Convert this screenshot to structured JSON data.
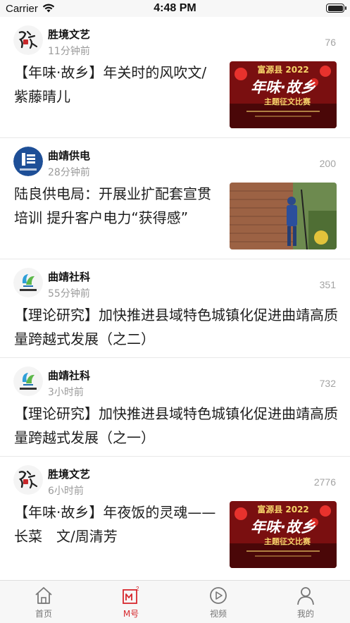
{
  "status_bar": {
    "carrier": "Carrier",
    "time": "4:48 PM"
  },
  "feed": [
    {
      "source": "胜境文艺",
      "time": "11分钟前",
      "count": "76",
      "title": "【年味·故乡】年关时的风吹文/紫藤晴儿",
      "thumbnail": "contest-poster",
      "thumb_text": {
        "header": "富源县 2022",
        "calligraphy": "年味·故乡",
        "subtitle": "主题征文比赛"
      }
    },
    {
      "source": "曲靖供电",
      "time": "28分钟前",
      "count": "200",
      "title": "陆良供电局：开展业扩配套宣贯培训 提升客户电力“获得感”",
      "thumbnail": "electric-worker-photo"
    },
    {
      "source": "曲靖社科",
      "time": "55分钟前",
      "count": "351",
      "title": "【理论研究】加快推进县域特色城镇化促进曲靖高质量跨越式发展（之二）"
    },
    {
      "source": "曲靖社科",
      "time": "3小时前",
      "count": "732",
      "title": "【理论研究】加快推进县域特色城镇化促进曲靖高质量跨越式发展（之一）"
    },
    {
      "source": "胜境文艺",
      "time": "6小时前",
      "count": "2776",
      "title": "【年味·故乡】年夜饭的灵魂——长菜　文/周清芳",
      "thumbnail": "contest-poster",
      "thumb_text": {
        "header": "富源县 2022",
        "calligraphy": "年味·故乡",
        "subtitle": "主题征文比赛"
      }
    }
  ],
  "tabs": [
    {
      "label": "首页",
      "icon": "home-icon",
      "active": false
    },
    {
      "label": "M号",
      "icon": "m-number-icon",
      "active": true
    },
    {
      "label": "视频",
      "icon": "play-icon",
      "active": false
    },
    {
      "label": "我的",
      "icon": "person-icon",
      "active": false
    }
  ],
  "colors": {
    "accent": "#d6282d",
    "tab_inactive": "#777777",
    "meta": "#9a9a9a",
    "divider": "#e8e8e8"
  }
}
